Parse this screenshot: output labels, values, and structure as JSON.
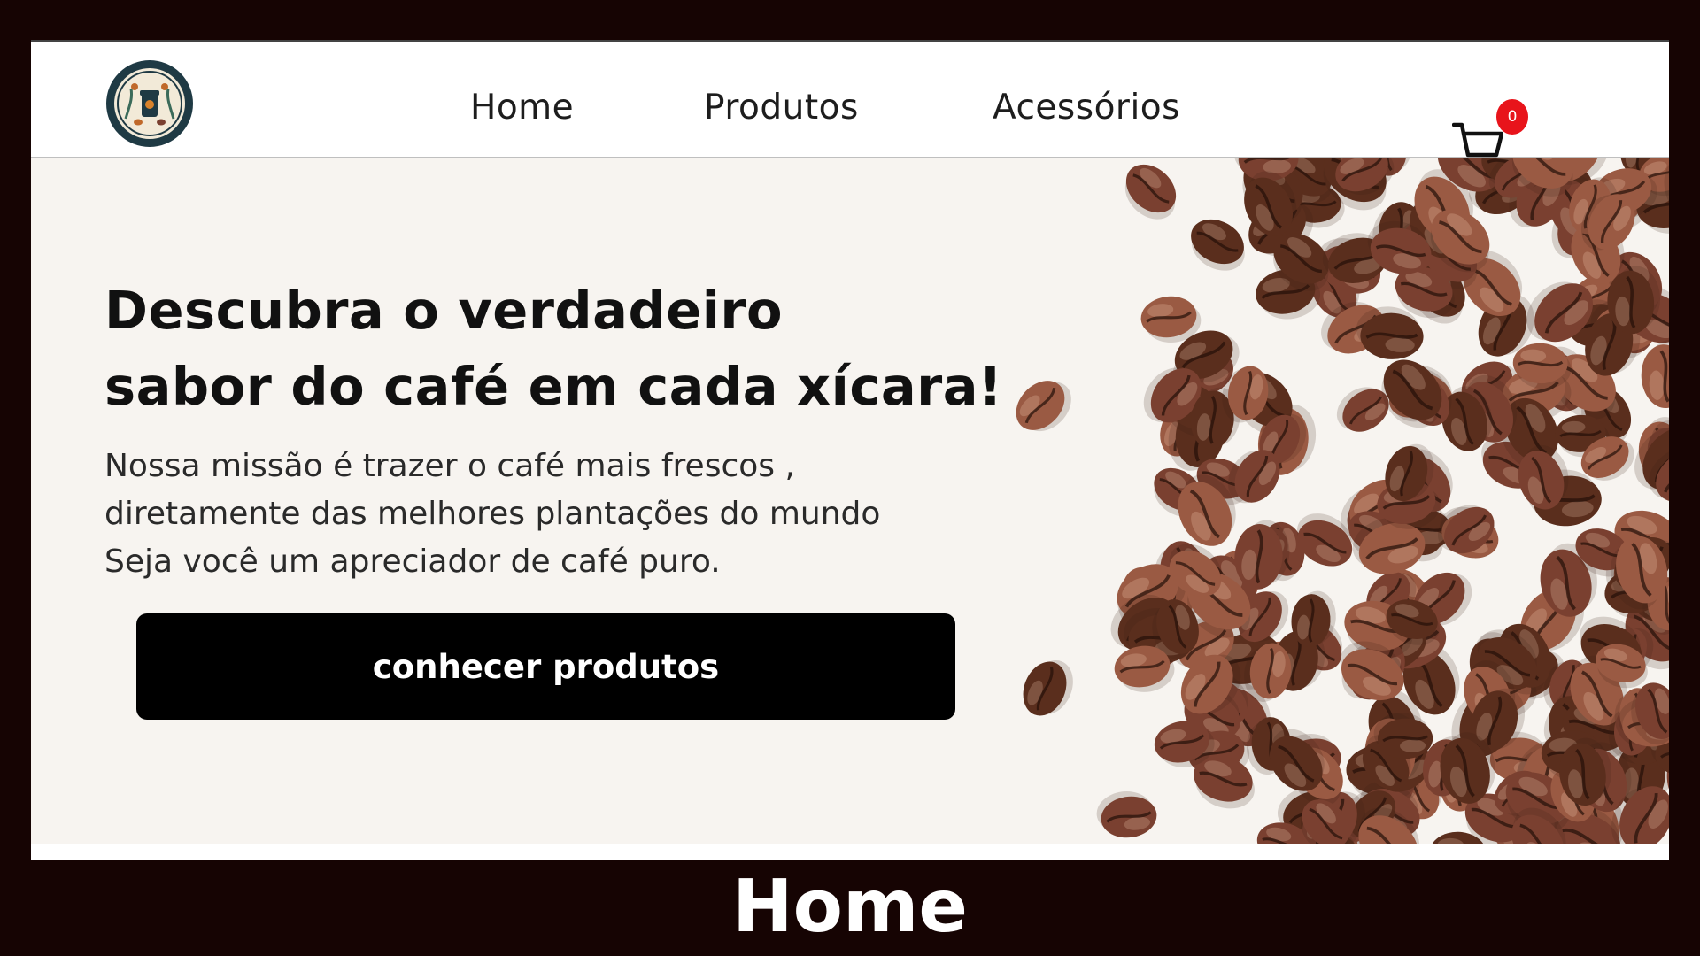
{
  "nav": {
    "links": [
      {
        "label": "Home"
      },
      {
        "label": "Produtos"
      },
      {
        "label": "Acessórios"
      }
    ],
    "cart_count": "0"
  },
  "hero": {
    "title_lines": [
      "Descubra o verdadeiro",
      "sabor do café em cada xícara!"
    ],
    "text_lines": [
      "Nossa missão é trazer o café mais frescos ,",
      "diretamente das melhores plantações do mundo",
      "Seja você um apreciador de café puro."
    ],
    "cta_label": "conhecer produtos"
  },
  "caption": "Home",
  "colors": {
    "frame": "#160403",
    "hero_bg": "#f7f4f0",
    "cta_bg": "#000000",
    "badge": "#e8141b",
    "bean_dark": "#5a2e1d",
    "bean_mid": "#7a4030",
    "bean_light": "#9a5a43"
  },
  "icons": {
    "logo": "coffee-logo-icon",
    "cart": "shopping-cart-icon"
  }
}
